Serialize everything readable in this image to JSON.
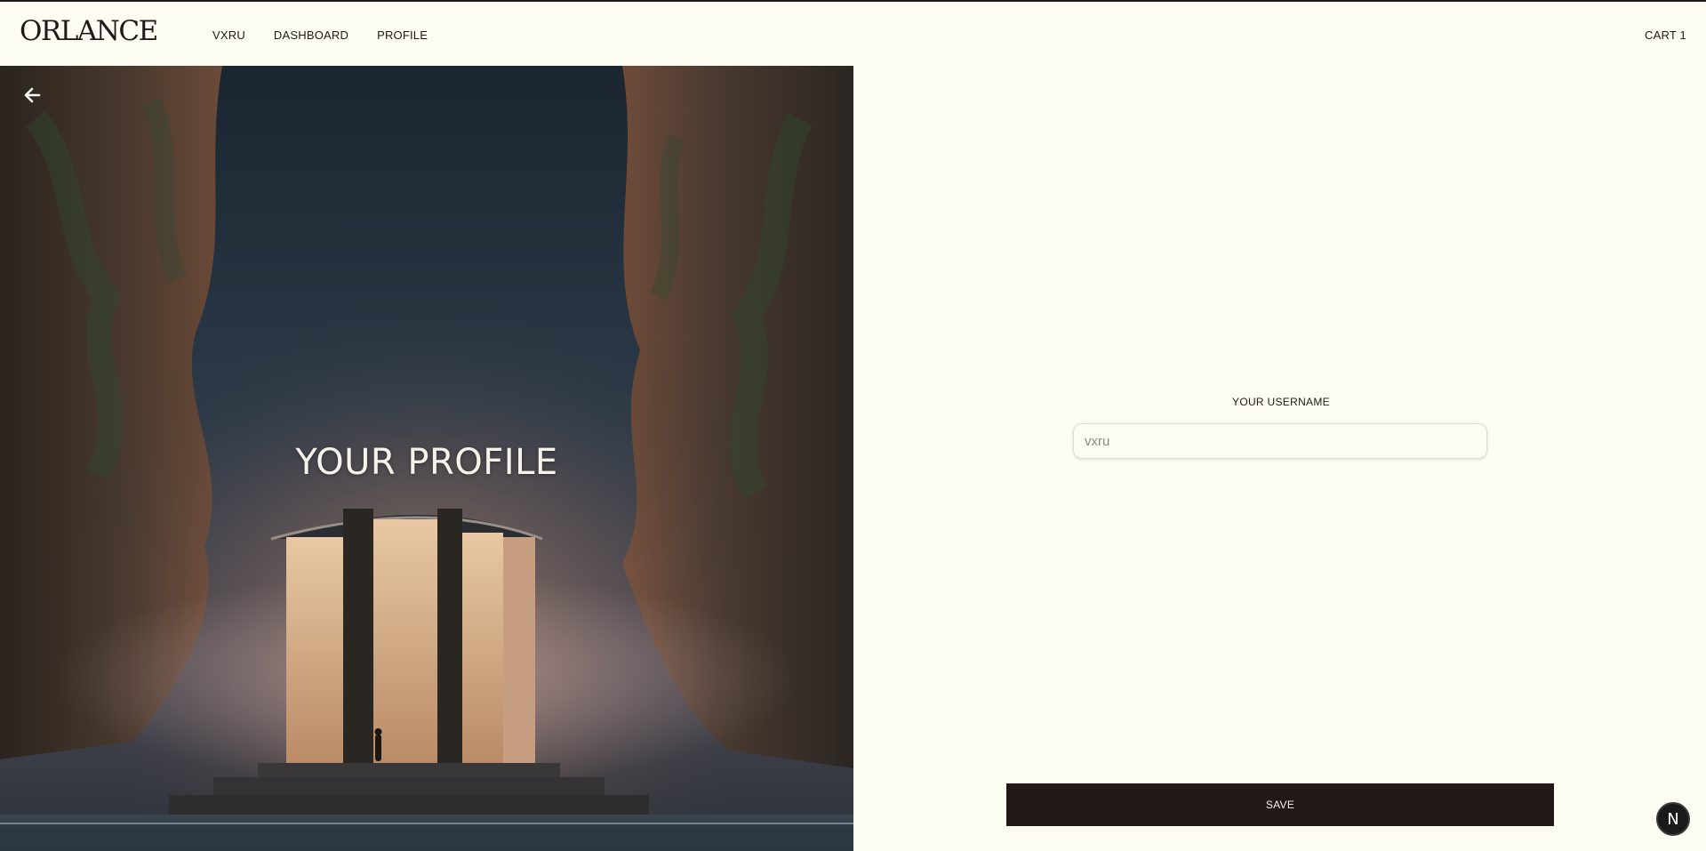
{
  "brand": {
    "logo": "ORLANCE"
  },
  "nav": {
    "items": [
      "VXRU",
      "DASHBOARD",
      "PROFILE"
    ]
  },
  "cart": {
    "label": "CART 1"
  },
  "hero": {
    "title": "YOUR PROFILE",
    "back_icon": "arrow-left-icon"
  },
  "form": {
    "username_label": "YOUR USERNAME",
    "username_placeholder": "vxru",
    "username_value": "",
    "save_label": "SAVE"
  },
  "badge": {
    "label": "N"
  },
  "colors": {
    "background": "#fcfcf2",
    "text": "#1e1a19",
    "button": "#211918"
  }
}
